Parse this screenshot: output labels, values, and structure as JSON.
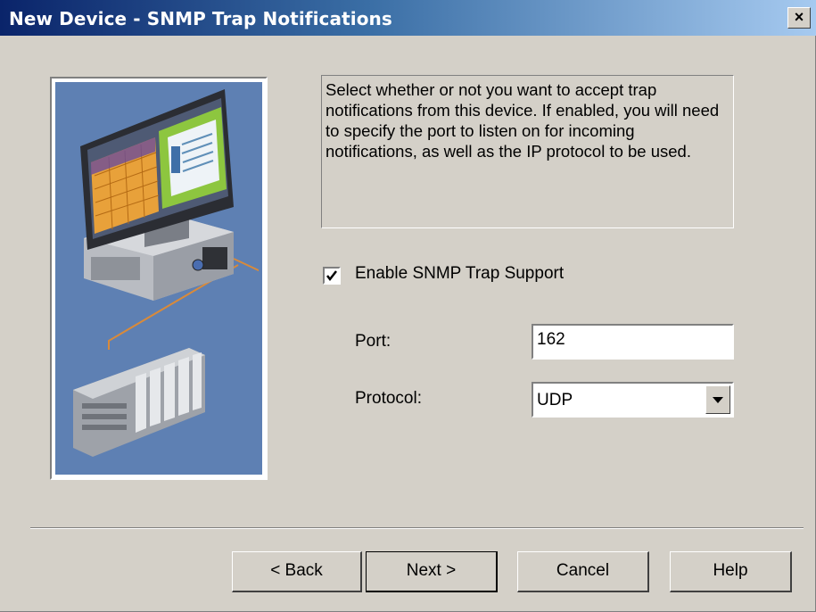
{
  "window": {
    "title": "New Device - SNMP Trap Notifications",
    "close_label": "×"
  },
  "description": "Select whether or not you want to accept trap notifications from this device. If enabled, you will need to specify the port to listen on for incoming notifications, as well as the IP protocol to be used.",
  "enable_trap": {
    "label": "Enable SNMP Trap Support",
    "checked": true
  },
  "port": {
    "label": "Port:",
    "value": "162"
  },
  "protocol": {
    "label": "Protocol:",
    "value": "UDP"
  },
  "buttons": {
    "back": "< Back",
    "next": "Next >",
    "cancel": "Cancel",
    "help": "Help"
  },
  "colors": {
    "dialog_bg": "#d4d0c8",
    "title_start": "#0a246a",
    "title_end": "#a6caf0",
    "graphic_bg": "#5e80b3"
  },
  "icons": [
    "close-icon",
    "check-icon",
    "dropdown-arrow-icon",
    "computer-device-illustration"
  ]
}
